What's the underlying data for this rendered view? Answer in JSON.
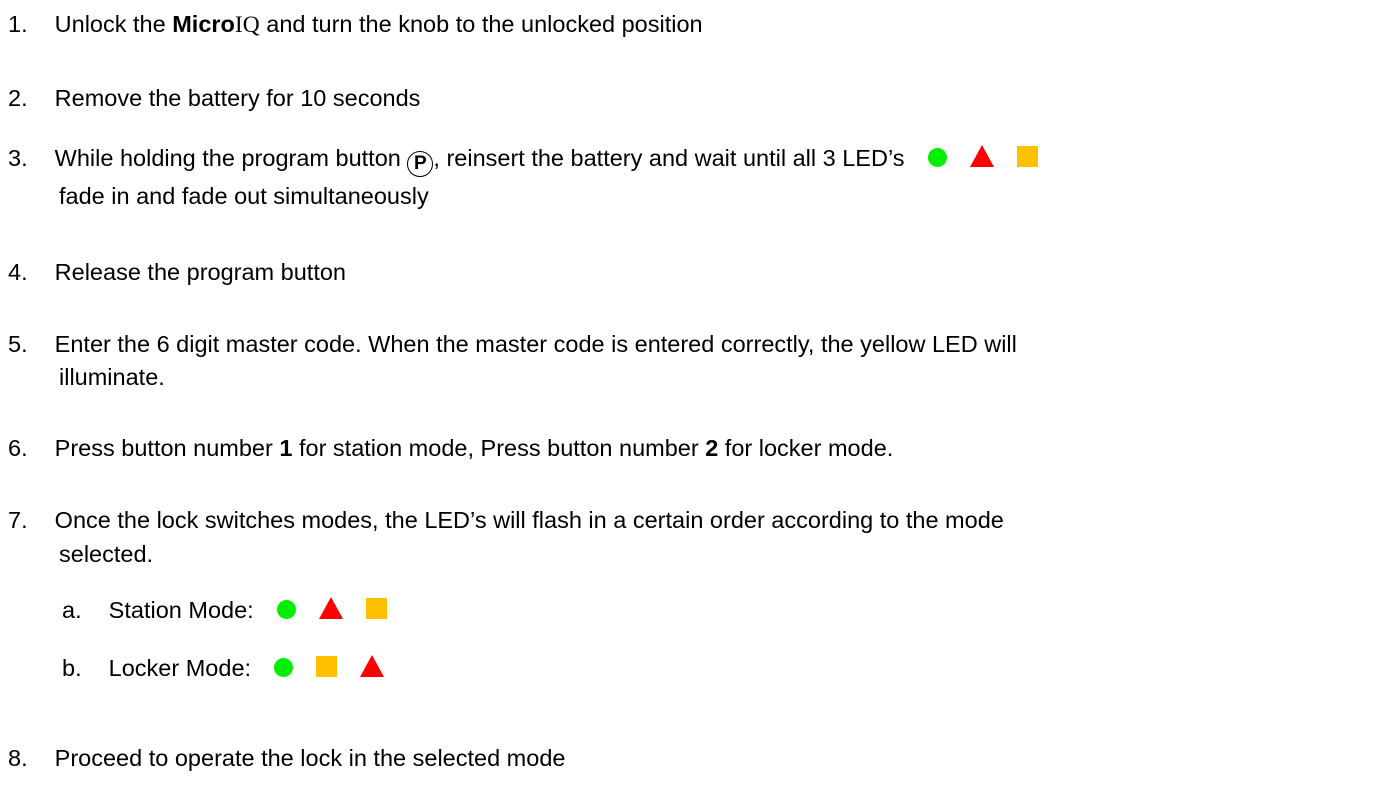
{
  "colors": {
    "green": "#00ee00",
    "red": "#ff0000",
    "yellow": "#ffc000"
  },
  "steps": [
    {
      "num": "1.",
      "pre": "Unlock the ",
      "brand_bold": "Micro",
      "brand_serif": "IQ",
      "post": " and turn the knob to the unlocked position"
    },
    {
      "num": "2.",
      "text": "Remove the battery for 10 seconds"
    },
    {
      "num": "3.",
      "pre": "While holding the program button ",
      "button_label": "P",
      "post": ", reinsert the battery and wait until all 3 LED’s",
      "line2": "fade in and fade out simultaneously",
      "leds": [
        "green-circle",
        "red-triangle",
        "yellow-square"
      ]
    },
    {
      "num": "4.",
      "text": "Release the program button"
    },
    {
      "num": "5.",
      "line1": "Enter the 6 digit master code. When the master code is entered correctly, the yellow LED will",
      "line2": "illuminate."
    },
    {
      "num": "6.",
      "pre": "Press button number ",
      "b1": "1",
      "mid": " for station mode, Press button number ",
      "b2": "2",
      "post": " for locker mode."
    },
    {
      "num": "7.",
      "line1": "Once the lock switches modes, the LED’s will flash in a certain order according to the mode",
      "line2": "selected.",
      "sub": [
        {
          "letter": "a.",
          "label": "Station Mode:",
          "leds": [
            "green-circle",
            "red-triangle",
            "yellow-square"
          ]
        },
        {
          "letter": "b.",
          "label": "Locker Mode:",
          "leds": [
            "green-circle",
            "yellow-square",
            "red-triangle"
          ]
        }
      ]
    },
    {
      "num": "8.",
      "text": "Proceed to operate the lock in the selected mode"
    }
  ]
}
